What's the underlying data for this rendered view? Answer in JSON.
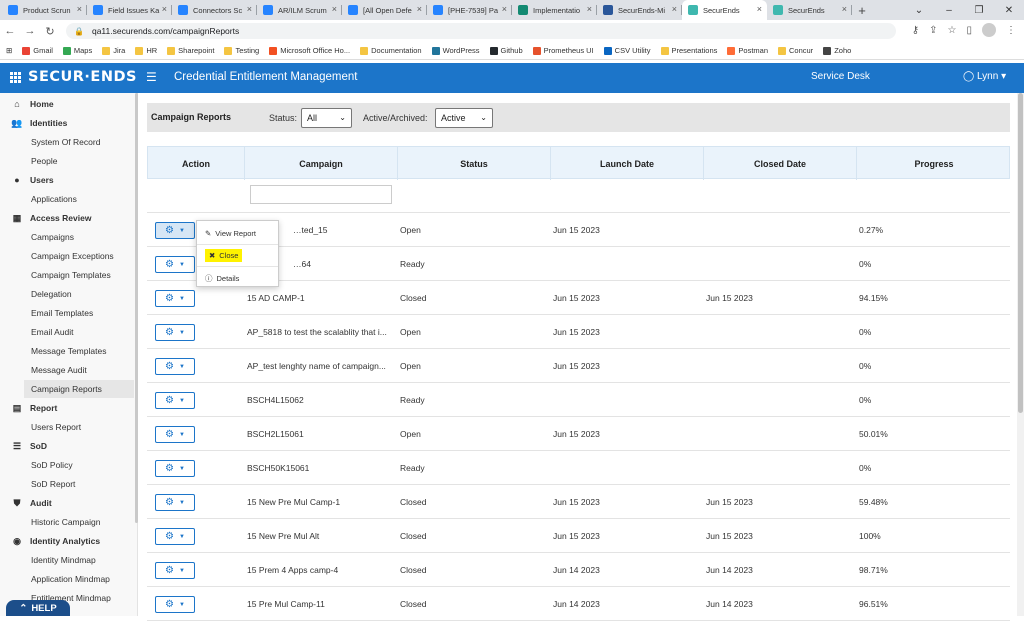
{
  "browser": {
    "tabs": [
      {
        "label": "Product Scrun",
        "color": "#2684ff"
      },
      {
        "label": "Field Issues Ka",
        "color": "#2684ff"
      },
      {
        "label": "Connectors Sc",
        "color": "#2684ff"
      },
      {
        "label": "AR/ILM Scrum",
        "color": "#2684ff"
      },
      {
        "label": "[All Open Defe",
        "color": "#2684ff"
      },
      {
        "label": "[PHE-7539] Pa",
        "color": "#2684ff"
      },
      {
        "label": "Implementatio",
        "color": "#138a72"
      },
      {
        "label": "SecurEnds-Mi",
        "color": "#2b579a"
      },
      {
        "label": "SecurEnds",
        "color": "#3fb8af",
        "active": true
      },
      {
        "label": "SecurEnds",
        "color": "#3fb8af"
      }
    ],
    "url": "qa11.securends.com/campaignReports",
    "bookmarks": [
      {
        "label": "Gmail",
        "color": "#ea4335"
      },
      {
        "label": "Maps",
        "color": "#34a853"
      },
      {
        "label": "Jira",
        "color": "#f4c542"
      },
      {
        "label": "HR",
        "color": "#f4c542"
      },
      {
        "label": "Sharepoint",
        "color": "#f4c542"
      },
      {
        "label": "Testing",
        "color": "#f4c542"
      },
      {
        "label": "Microsoft Office Ho...",
        "color": "#f25022"
      },
      {
        "label": "Documentation",
        "color": "#f4c542"
      },
      {
        "label": "WordPress",
        "color": "#21759b"
      },
      {
        "label": "Github",
        "color": "#24292e"
      },
      {
        "label": "Prometheus UI",
        "color": "#e6522c"
      },
      {
        "label": "CSV Utility",
        "color": "#0a66c2"
      },
      {
        "label": "Presentations",
        "color": "#f4c542"
      },
      {
        "label": "Postman",
        "color": "#ff6c37"
      },
      {
        "label": "Concur",
        "color": "#f4c542"
      },
      {
        "label": "Zoho",
        "color": "#444444"
      }
    ]
  },
  "header": {
    "logo": "SECUR·ENDS",
    "title": "Credential Entitlement Management",
    "service_desk": "Service Desk",
    "user": "Lynn"
  },
  "sidebar": [
    {
      "type": "section",
      "label": "Home",
      "icon": "home-icon",
      "glyph": "⌂"
    },
    {
      "type": "section",
      "label": "Identities",
      "icon": "users-icon",
      "glyph": "👥"
    },
    {
      "type": "sub",
      "label": "System Of Record"
    },
    {
      "type": "sub",
      "label": "People"
    },
    {
      "type": "section",
      "label": "Users",
      "icon": "user-icon",
      "glyph": "●"
    },
    {
      "type": "sub",
      "label": "Applications"
    },
    {
      "type": "section",
      "label": "Access Review",
      "icon": "grid-icon",
      "glyph": "▦"
    },
    {
      "type": "sub",
      "label": "Campaigns"
    },
    {
      "type": "sub",
      "label": "Campaign Exceptions"
    },
    {
      "type": "sub",
      "label": "Campaign Templates"
    },
    {
      "type": "sub",
      "label": "Delegation"
    },
    {
      "type": "sub",
      "label": "Email Templates"
    },
    {
      "type": "sub",
      "label": "Email Audit"
    },
    {
      "type": "sub",
      "label": "Message Templates"
    },
    {
      "type": "sub",
      "label": "Message Audit"
    },
    {
      "type": "sub",
      "label": "Campaign Reports",
      "active": true
    },
    {
      "type": "section",
      "label": "Report",
      "icon": "report-icon",
      "glyph": "▤"
    },
    {
      "type": "sub",
      "label": "Users Report"
    },
    {
      "type": "section",
      "label": "SoD",
      "icon": "list-icon",
      "glyph": "☰"
    },
    {
      "type": "sub",
      "label": "SoD Policy"
    },
    {
      "type": "sub",
      "label": "SoD Report"
    },
    {
      "type": "section",
      "label": "Audit",
      "icon": "shield-icon",
      "glyph": "⛊"
    },
    {
      "type": "sub",
      "label": "Historic Campaign"
    },
    {
      "type": "section",
      "label": "Identity Analytics",
      "icon": "analytics-icon",
      "glyph": "◉"
    },
    {
      "type": "sub",
      "label": "Identity Mindmap"
    },
    {
      "type": "sub",
      "label": "Application Mindmap"
    },
    {
      "type": "sub",
      "label": "Entitlement Mindmap"
    }
  ],
  "help_label": "HELP",
  "toolbar": {
    "title": "Campaign Reports",
    "status_label": "Status:",
    "status_value": "All",
    "archived_label": "Active/Archived:",
    "archived_value": "Active"
  },
  "table": {
    "columns": [
      "Action",
      "Campaign",
      "Status",
      "Launch Date",
      "Closed Date",
      "Progress"
    ],
    "rows": [
      {
        "campaign": "…ted_15",
        "status": "Open",
        "launch": "Jun 15 2023",
        "closed": "",
        "progress": "0.27%"
      },
      {
        "campaign": "…64",
        "status": "Ready",
        "launch": "",
        "closed": "",
        "progress": "0%"
      },
      {
        "campaign": "15 AD CAMP-1",
        "status": "Closed",
        "launch": "Jun 15 2023",
        "closed": "Jun 15 2023",
        "progress": "94.15%"
      },
      {
        "campaign": "AP_5818 to test the scalablity that i...",
        "status": "Open",
        "launch": "Jun 15 2023",
        "closed": "",
        "progress": "0%"
      },
      {
        "campaign": "AP_test lenghty name of campaign...",
        "status": "Open",
        "launch": "Jun 15 2023",
        "closed": "",
        "progress": "0%"
      },
      {
        "campaign": "BSCH4L15062",
        "status": "Ready",
        "launch": "",
        "closed": "",
        "progress": "0%"
      },
      {
        "campaign": "BSCH2L15061",
        "status": "Open",
        "launch": "Jun 15 2023",
        "closed": "",
        "progress": "50.01%"
      },
      {
        "campaign": "BSCH50K15061",
        "status": "Ready",
        "launch": "",
        "closed": "",
        "progress": "0%"
      },
      {
        "campaign": "15 New Pre Mul Camp-1",
        "status": "Closed",
        "launch": "Jun 15 2023",
        "closed": "Jun 15 2023",
        "progress": "59.48%"
      },
      {
        "campaign": "15 New Pre Mul Alt",
        "status": "Closed",
        "launch": "Jun 15 2023",
        "closed": "Jun 15 2023",
        "progress": "100%"
      },
      {
        "campaign": "15 Prem 4 Apps camp-4",
        "status": "Closed",
        "launch": "Jun 14 2023",
        "closed": "Jun 14 2023",
        "progress": "98.71%"
      },
      {
        "campaign": "15 Pre Mul Camp-11",
        "status": "Closed",
        "launch": "Jun 14 2023",
        "closed": "Jun 14 2023",
        "progress": "96.51%"
      }
    ]
  },
  "action_menu": [
    {
      "label": "View Report",
      "icon": "edit-icon",
      "glyph": "✎"
    },
    {
      "label": "Close",
      "icon": "close-icon",
      "glyph": "✖",
      "highlight": true
    },
    {
      "label": "Details",
      "icon": "info-icon",
      "glyph": "ⓘ"
    }
  ]
}
